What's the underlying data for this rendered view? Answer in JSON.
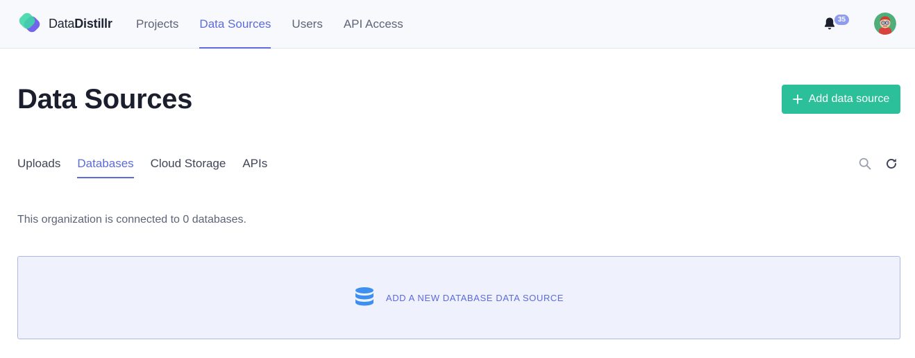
{
  "brand": {
    "name_light": "Data",
    "name_bold": "Distillr"
  },
  "nav": {
    "items": [
      {
        "label": "Projects",
        "active": false
      },
      {
        "label": "Data Sources",
        "active": true
      },
      {
        "label": "Users",
        "active": false
      },
      {
        "label": "API Access",
        "active": false
      }
    ]
  },
  "header_actions": {
    "notification_count": "35",
    "bell_icon": "bell-icon",
    "avatar_icon": "user-avatar"
  },
  "page": {
    "title": "Data Sources",
    "add_button_label": "Add data source"
  },
  "tabs": {
    "items": [
      {
        "label": "Uploads",
        "active": false
      },
      {
        "label": "Databases",
        "active": true
      },
      {
        "label": "Cloud Storage",
        "active": false
      },
      {
        "label": "APIs",
        "active": false
      }
    ],
    "tools": [
      "search-icon",
      "refresh-icon"
    ]
  },
  "content": {
    "info_text": "This organization is connected to 0 databases.",
    "empty_card_label": "ADD A NEW DATABASE DATA SOURCE",
    "empty_card_icon": "database-icon"
  },
  "colors": {
    "accent": "#5b6bdc",
    "primary_button": "#2bbf9a",
    "badge": "#8f9bef",
    "empty_card_bg": "#eff1fc",
    "empty_card_border": "#aeb7ec"
  }
}
